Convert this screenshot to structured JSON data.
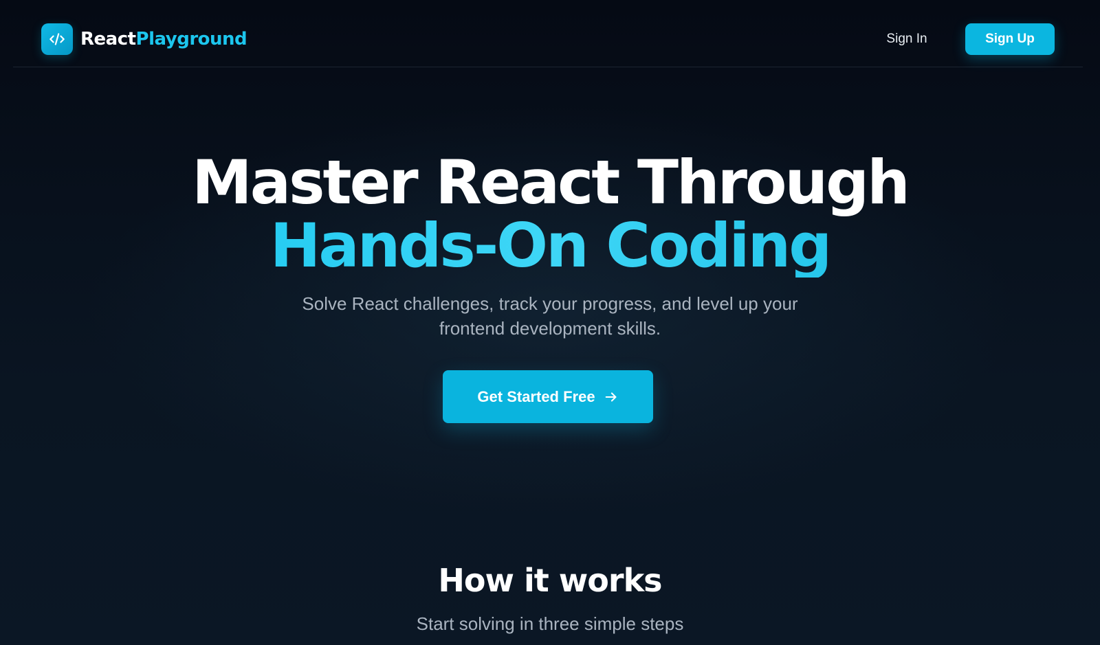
{
  "header": {
    "brand": {
      "part1": "React",
      "part2": "Playground",
      "icon": "code-brackets-icon"
    },
    "signin_label": "Sign In",
    "signup_label": "Sign Up"
  },
  "hero": {
    "title_line1": "Master React Through",
    "title_line2": "Hands-On Coding",
    "subtitle": "Solve React challenges, track your progress, and level up your frontend development skills.",
    "cta_label": "Get Started Free",
    "cta_icon": "arrow-right-icon"
  },
  "how_it_works": {
    "title": "How it works",
    "subtitle": "Start solving in three simple steps"
  },
  "colors": {
    "accent": "#0ab4de",
    "accent_text": "#1cc6ee",
    "background": "#070d17",
    "muted_text": "#aab4c0"
  }
}
